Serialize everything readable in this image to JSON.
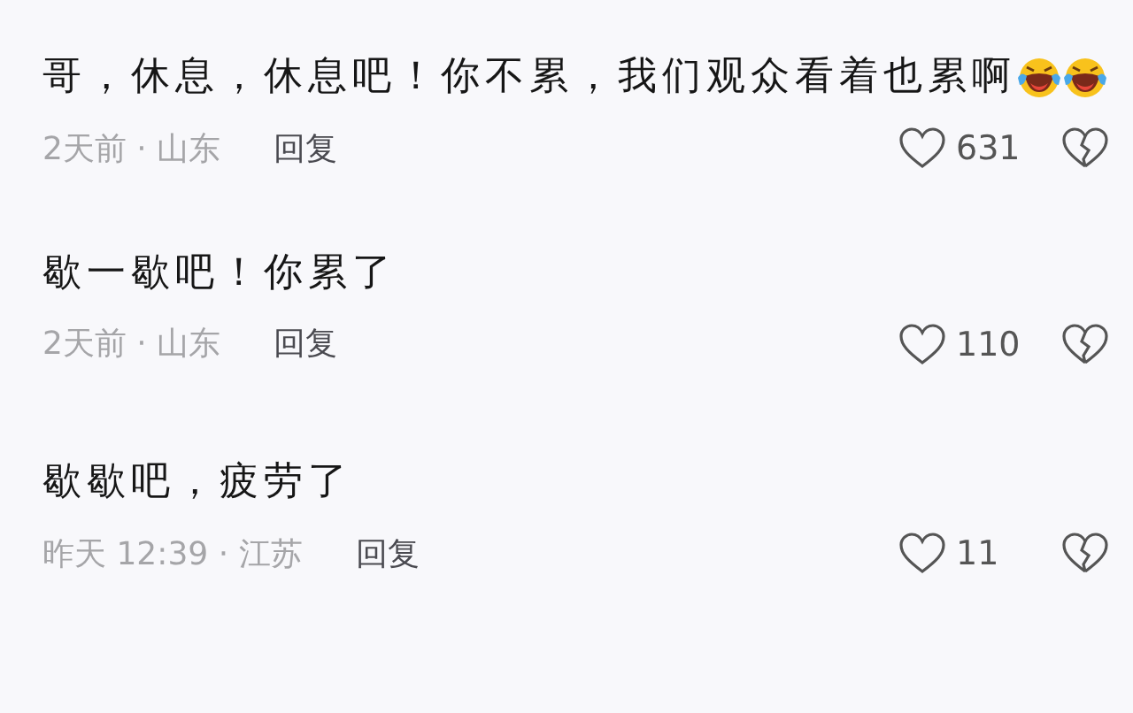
{
  "comments": [
    {
      "text": "哥，休息，休息吧！你不累，我们观众看着也累啊",
      "emojis": [
        {
          "kind": "laughing-tears"
        },
        {
          "kind": "laughing-tears"
        }
      ],
      "meta": "2天前 · 山东",
      "reply": "回复",
      "likes": "631"
    },
    {
      "text": "歇一歇吧！你累了",
      "meta": "2天前 · 山东",
      "reply": "回复",
      "likes": "110"
    },
    {
      "text": "歇歇吧，疲劳了",
      "meta": "昨天 12:39 · 江苏",
      "reply": "回复",
      "likes": "11"
    }
  ]
}
